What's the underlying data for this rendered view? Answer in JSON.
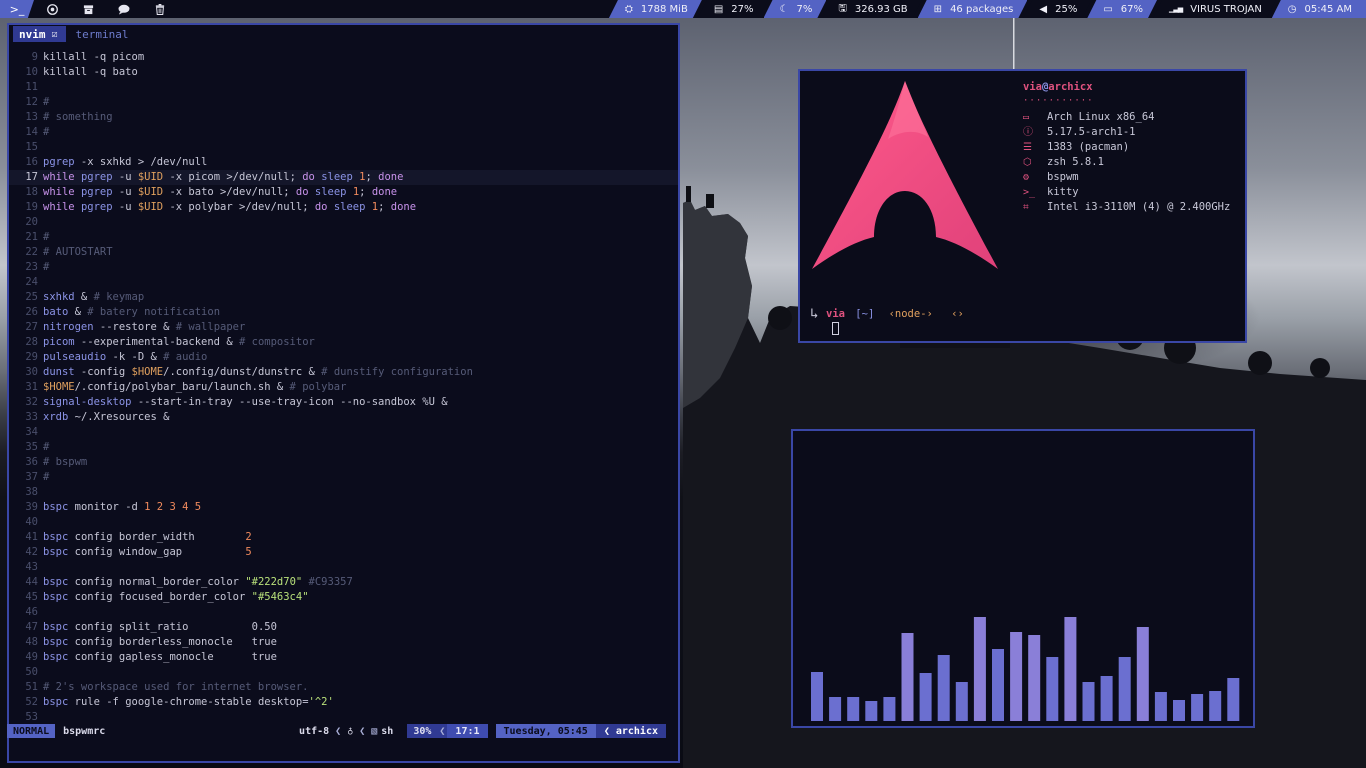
{
  "topbar": {
    "left_icons": [
      "terminal-icon",
      "chrome-icon",
      "archive-icon",
      "chat-icon",
      "trash-icon"
    ],
    "modules": [
      {
        "name": "memory",
        "icon": "memory-icon",
        "glyph": "⛭",
        "text": "1788 MiB",
        "style": "blue"
      },
      {
        "name": "disk-usage",
        "icon": "disk-icon",
        "glyph": "▤",
        "text": "27%",
        "style": "dark"
      },
      {
        "name": "brightness",
        "icon": "moon-icon",
        "glyph": "☾",
        "text": "7%",
        "style": "blue"
      },
      {
        "name": "storage",
        "icon": "drive-icon",
        "glyph": "🖫",
        "text": "326.93 GB",
        "style": "dark"
      },
      {
        "name": "packages",
        "icon": "package-icon",
        "glyph": "⊞",
        "text": "46 packages",
        "style": "blue"
      },
      {
        "name": "volume",
        "icon": "speaker-icon",
        "glyph": "◀",
        "text": "25%",
        "style": "dark"
      },
      {
        "name": "battery",
        "icon": "battery-icon",
        "glyph": "▭",
        "text": "67%",
        "style": "blue"
      },
      {
        "name": "network",
        "icon": "wifi-icon",
        "glyph": "▁▃▅",
        "text": "VIRUS TROJAN",
        "style": "dark"
      },
      {
        "name": "clock",
        "icon": "clock-icon",
        "glyph": "◷",
        "text": "05:45 AM",
        "style": "blue"
      }
    ]
  },
  "editor": {
    "active_tab": "nvim",
    "inactive_tab": "terminal",
    "current_line": 17,
    "lines": [
      {
        "n": "9",
        "t": [
          [
            "killall -q picom",
            "plain"
          ]
        ]
      },
      {
        "n": "10",
        "t": [
          [
            "killall -q bato",
            "plain"
          ]
        ]
      },
      {
        "n": "11",
        "t": []
      },
      {
        "n": "12",
        "t": [
          [
            "#",
            "cmt"
          ]
        ]
      },
      {
        "n": "13",
        "t": [
          [
            "# something",
            "cmt"
          ]
        ]
      },
      {
        "n": "14",
        "t": [
          [
            "#",
            "cmt"
          ]
        ]
      },
      {
        "n": "15",
        "t": []
      },
      {
        "n": "16",
        "t": [
          [
            "pgrep",
            "key"
          ],
          [
            " -x sxhkd > /dev/null",
            "plain"
          ]
        ]
      },
      {
        "n": "17",
        "t": [
          [
            "while",
            "kw"
          ],
          [
            " ",
            "plain"
          ],
          [
            "pgrep",
            "key"
          ],
          [
            " -u ",
            "plain"
          ],
          [
            "$UID",
            "var"
          ],
          [
            " -x picom >/dev/null; ",
            "plain"
          ],
          [
            "do",
            "kw"
          ],
          [
            " ",
            "plain"
          ],
          [
            "sleep",
            "key"
          ],
          [
            " ",
            "plain"
          ],
          [
            "1",
            "num"
          ],
          [
            "; ",
            "plain"
          ],
          [
            "done",
            "kw"
          ]
        ]
      },
      {
        "n": "18",
        "t": [
          [
            "while",
            "kw"
          ],
          [
            " ",
            "plain"
          ],
          [
            "pgrep",
            "key"
          ],
          [
            " -u ",
            "plain"
          ],
          [
            "$UID",
            "var"
          ],
          [
            " -x bato >/dev/null; ",
            "plain"
          ],
          [
            "do",
            "kw"
          ],
          [
            " ",
            "plain"
          ],
          [
            "sleep",
            "key"
          ],
          [
            " ",
            "plain"
          ],
          [
            "1",
            "num"
          ],
          [
            "; ",
            "plain"
          ],
          [
            "done",
            "kw"
          ]
        ]
      },
      {
        "n": "19",
        "t": [
          [
            "while",
            "kw"
          ],
          [
            " ",
            "plain"
          ],
          [
            "pgrep",
            "key"
          ],
          [
            " -u ",
            "plain"
          ],
          [
            "$UID",
            "var"
          ],
          [
            " -x polybar >/dev/null; ",
            "plain"
          ],
          [
            "do",
            "kw"
          ],
          [
            " ",
            "plain"
          ],
          [
            "sleep",
            "key"
          ],
          [
            " ",
            "plain"
          ],
          [
            "1",
            "num"
          ],
          [
            "; ",
            "plain"
          ],
          [
            "done",
            "kw"
          ]
        ]
      },
      {
        "n": "20",
        "t": []
      },
      {
        "n": "21",
        "t": [
          [
            "#",
            "cmt"
          ]
        ]
      },
      {
        "n": "22",
        "t": [
          [
            "# AUTOSTART",
            "cmt"
          ]
        ]
      },
      {
        "n": "23",
        "t": [
          [
            "#",
            "cmt"
          ]
        ]
      },
      {
        "n": "24",
        "t": []
      },
      {
        "n": "25",
        "t": [
          [
            "sxhkd",
            "key"
          ],
          [
            " & ",
            "plain"
          ],
          [
            "# keymap",
            "cmt"
          ]
        ]
      },
      {
        "n": "26",
        "t": [
          [
            "bato",
            "key"
          ],
          [
            " & ",
            "plain"
          ],
          [
            "# batery notification",
            "cmt"
          ]
        ]
      },
      {
        "n": "27",
        "t": [
          [
            "nitrogen",
            "key"
          ],
          [
            " --restore & ",
            "plain"
          ],
          [
            "# wallpaper",
            "cmt"
          ]
        ]
      },
      {
        "n": "28",
        "t": [
          [
            "picom",
            "key"
          ],
          [
            " --experimental-backend & ",
            "plain"
          ],
          [
            "# compositor",
            "cmt"
          ]
        ]
      },
      {
        "n": "29",
        "t": [
          [
            "pulseaudio",
            "key"
          ],
          [
            " -k -D & ",
            "plain"
          ],
          [
            "# audio",
            "cmt"
          ]
        ]
      },
      {
        "n": "30",
        "t": [
          [
            "dunst",
            "key"
          ],
          [
            " -config ",
            "plain"
          ],
          [
            "$HOME",
            "var"
          ],
          [
            "/.config/dunst/dunstrc & ",
            "plain"
          ],
          [
            "# dunstify configuration",
            "cmt"
          ]
        ]
      },
      {
        "n": "31",
        "t": [
          [
            "$HOME",
            "var"
          ],
          [
            "/.config/polybar_baru/launch.sh & ",
            "plain"
          ],
          [
            "# polybar",
            "cmt"
          ]
        ]
      },
      {
        "n": "32",
        "t": [
          [
            "signal-desktop",
            "key"
          ],
          [
            " --start-in-tray --use-tray-icon --no-sandbox %U &",
            "plain"
          ]
        ]
      },
      {
        "n": "33",
        "t": [
          [
            "xrdb",
            "key"
          ],
          [
            " ~/.Xresources &",
            "plain"
          ]
        ]
      },
      {
        "n": "34",
        "t": []
      },
      {
        "n": "35",
        "t": [
          [
            "#",
            "cmt"
          ]
        ]
      },
      {
        "n": "36",
        "t": [
          [
            "# bspwm",
            "cmt"
          ]
        ]
      },
      {
        "n": "37",
        "t": [
          [
            "#",
            "cmt"
          ]
        ]
      },
      {
        "n": "38",
        "t": []
      },
      {
        "n": "39",
        "t": [
          [
            "bspc",
            "key"
          ],
          [
            " monitor -d ",
            "plain"
          ],
          [
            "1 2 3 4 5",
            "num"
          ]
        ]
      },
      {
        "n": "40",
        "t": []
      },
      {
        "n": "41",
        "t": [
          [
            "bspc",
            "key"
          ],
          [
            " config border_width        ",
            "plain"
          ],
          [
            "2",
            "num"
          ]
        ]
      },
      {
        "n": "42",
        "t": [
          [
            "bspc",
            "key"
          ],
          [
            " config window_gap          ",
            "plain"
          ],
          [
            "5",
            "num"
          ]
        ]
      },
      {
        "n": "43",
        "t": []
      },
      {
        "n": "44",
        "t": [
          [
            "bspc",
            "key"
          ],
          [
            " config normal_border_color ",
            "plain"
          ],
          [
            "\"#222d70\"",
            "str"
          ],
          [
            " #C93357",
            "cmt"
          ]
        ]
      },
      {
        "n": "45",
        "t": [
          [
            "bspc",
            "key"
          ],
          [
            " config focused_border_color ",
            "plain"
          ],
          [
            "\"#5463c4\"",
            "str"
          ]
        ]
      },
      {
        "n": "46",
        "t": []
      },
      {
        "n": "47",
        "t": [
          [
            "bspc",
            "key"
          ],
          [
            " config split_ratio          0.50",
            "plain"
          ]
        ]
      },
      {
        "n": "48",
        "t": [
          [
            "bspc",
            "key"
          ],
          [
            " config borderless_monocle   true",
            "plain"
          ]
        ]
      },
      {
        "n": "49",
        "t": [
          [
            "bspc",
            "key"
          ],
          [
            " config gapless_monocle      true",
            "plain"
          ]
        ]
      },
      {
        "n": "50",
        "t": []
      },
      {
        "n": "51",
        "t": [
          [
            "# 2's workspace used for internet browser.",
            "cmt"
          ]
        ]
      },
      {
        "n": "52",
        "t": [
          [
            "bspc",
            "key"
          ],
          [
            " rule -f google-chrome-stable desktop=",
            "plain"
          ],
          [
            "'^2'",
            "str"
          ]
        ]
      },
      {
        "n": "53",
        "t": []
      }
    ],
    "statusline": {
      "mode": "NORMAL",
      "file": "bspwmrc",
      "encoding": "utf-8",
      "git_glyph": "♁",
      "filetype_glyph": "▧",
      "filetype": "sh",
      "percent": "30%",
      "position": "17:1",
      "datetime": "Tuesday, 05:45",
      "host": "archicx"
    }
  },
  "fetch": {
    "user": "via",
    "at": "@",
    "host": "archicx",
    "separator": "···········",
    "rows": [
      {
        "icon": "monitor-icon",
        "glyph": "▭",
        "text": "Arch Linux x86_64"
      },
      {
        "icon": "info-icon",
        "glyph": "ⓘ",
        "text": "5.17.5-arch1-1"
      },
      {
        "icon": "server-icon",
        "glyph": "☰",
        "text": "1383 (pacman)"
      },
      {
        "icon": "shell-icon",
        "glyph": "⬡",
        "text": "zsh 5.8.1"
      },
      {
        "icon": "wm-icon",
        "glyph": "⚙",
        "text": "bspwm"
      },
      {
        "icon": "terminal-prompt-icon",
        "glyph": ">_",
        "text": "kitty"
      },
      {
        "icon": "cpu-icon",
        "glyph": "⌗",
        "text": "Intel i3-3110M (4) @ 2.400GHz"
      }
    ],
    "prompt": {
      "user": "via",
      "dir": "[~]",
      "node": "‹node-›",
      "git": "‹›"
    }
  },
  "visualizer": {
    "bar_color": "#6b6fd0",
    "bar_color_high": "#8a7fd8",
    "levels": [
      0.46,
      0.23,
      0.23,
      0.19,
      0.23,
      0.83,
      0.45,
      0.62,
      0.37,
      0.98,
      0.68,
      0.84,
      0.81,
      0.6,
      0.98,
      0.37,
      0.42,
      0.6,
      0.89,
      0.27,
      0.2,
      0.25,
      0.28,
      0.41
    ]
  },
  "colors": {
    "accent": "#5463c4",
    "border": "#3a47a6",
    "arch_pink": "#e0527f"
  }
}
